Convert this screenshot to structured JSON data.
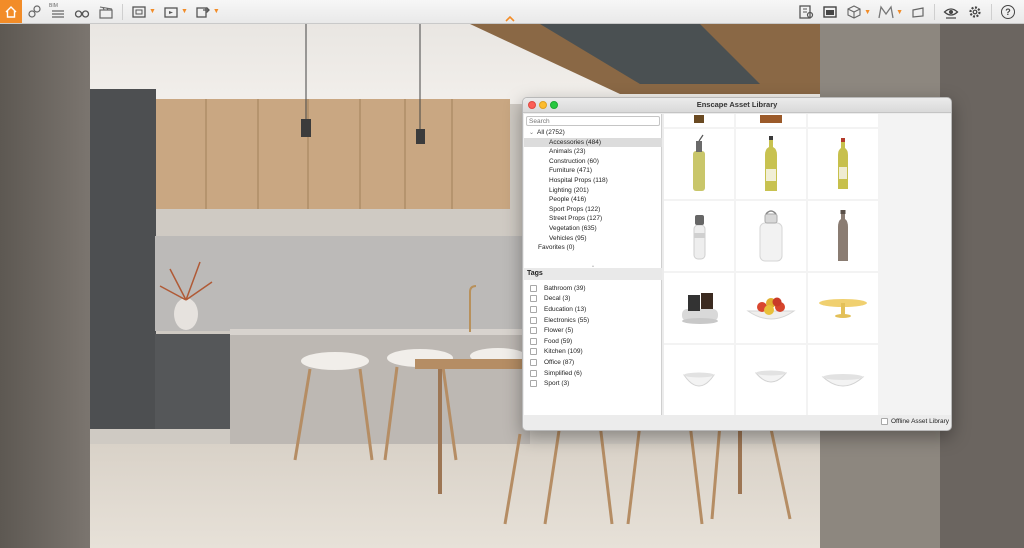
{
  "toolbar": {
    "left_icons": [
      "home-icon",
      "gps-pin-icon",
      "bim-icon",
      "binoculars-icon",
      "clapperboard-icon",
      "screenshot-icon",
      "video-icon",
      "export-icon"
    ],
    "bim_label": "BIM",
    "right_icons": [
      "asset-library-icon",
      "render-window-icon",
      "cube-icon",
      "material-editor-icon",
      "upload-icon",
      "visual-settings-icon",
      "settings-gear-icon",
      "help-icon"
    ],
    "help_label": "?",
    "accent_color": "#f28c28"
  },
  "window": {
    "title": "Enscape Asset Library",
    "search_placeholder": "Search",
    "tree": {
      "root": "All (2752)",
      "categories": [
        "Accessories (484)",
        "Animals (23)",
        "Construction (60)",
        "Furniture (471)",
        "Hospital Props (118)",
        "Lighting (201)",
        "People (416)",
        "Sport Props (122)",
        "Street Props (127)",
        "Vegetation (635)",
        "Vehicles (95)"
      ],
      "selected": "Accessories (484)",
      "favorites": "Favorites (0)"
    },
    "tags_header": "Tags",
    "tags": [
      "Bathroom (39)",
      "Decal (3)",
      "Education (13)",
      "Electronics (55)",
      "Flower (5)",
      "Food (59)",
      "Kitchen (109)",
      "Office (87)",
      "Simplified (6)",
      "Sport (3)"
    ],
    "assets": [
      "partial-item",
      "partial-item",
      "empty",
      "oil-bottle-with-pourer",
      "olive-oil-bottle",
      "olive-oil-bottle-small",
      "white-sport-bottle",
      "plastic-water-jug",
      "steel-water-bottle",
      "utensil-holder-tray",
      "apple-bowl",
      "cake-stand",
      "white-bowl",
      "white-bowl-small",
      "white-serving-bowl"
    ],
    "offline_label": "Offline Asset Library"
  }
}
